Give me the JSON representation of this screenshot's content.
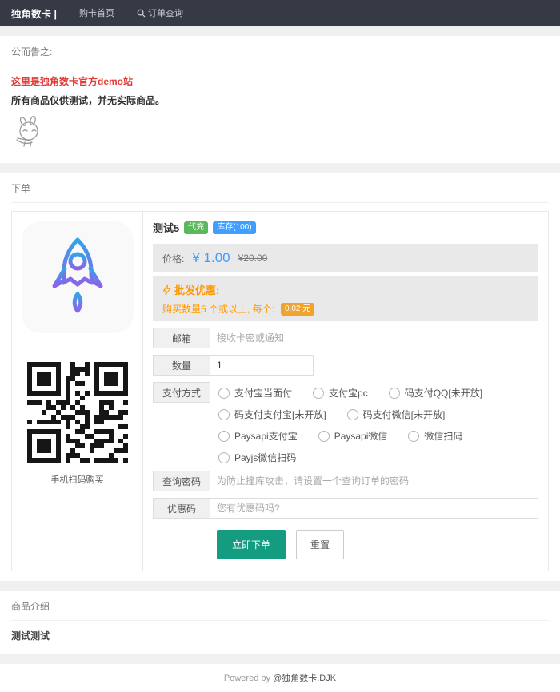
{
  "navbar": {
    "brand": "独角数卡 |",
    "home_label": "购卡首页",
    "order_query_label": "订单查询"
  },
  "announcement": {
    "title": "公而告之:",
    "line1": "这里是独角数卡官方demo站",
    "line2": "所有商品仅供测试，并无实际商品。"
  },
  "order": {
    "title": "下单",
    "product": {
      "name": "测试5",
      "type_badge": "代充",
      "stock_badge": "库存(100)",
      "price_label": "价格:",
      "price": "¥ 1.00",
      "original_price": "¥20.00",
      "wholesale_title": "批发优惠:",
      "wholesale_desc": "购买数量5 个或以上, 每个:",
      "wholesale_badge": "0.02 元",
      "qr_caption": "手机扫码购买"
    },
    "form": {
      "email_label": "邮箱",
      "email_placeholder": "接收卡密或通知",
      "quantity_label": "数量",
      "quantity_value": "1",
      "payment_label": "支付方式",
      "payments": [
        "支付宝当面付",
        "支付宝pc",
        "码支付QQ[未开放]",
        "码支付支付宝[未开放]",
        "码支付微信[未开放]",
        "Paysapi支付宝",
        "Paysapi微信",
        "微信扫码",
        "Payjs微信扫码"
      ],
      "search_pwd_label": "查询密码",
      "search_pwd_placeholder": "为防止撞库攻击，请设置一个查询订单的密码",
      "coupon_label": "优惠码",
      "coupon_placeholder": "您有优惠码吗?",
      "submit_label": "立即下单",
      "reset_label": "重置"
    }
  },
  "detail": {
    "title": "商品介绍",
    "content": "测试测试"
  },
  "footer": {
    "powered": "Powered by ",
    "brand": "@独角数卡.DJK"
  },
  "icons": {
    "nav_query": "search-icon",
    "wholesale": "lightning-icon",
    "product_image": "rocket-icon",
    "qr": "qr-code",
    "announcement_image": "kaomoji-emoticon"
  },
  "colors": {
    "navbar_bg": "#353a45",
    "red": "#e53935",
    "price_blue": "#409eff",
    "orange": "#ff9800",
    "badge_green": "#5cb85c",
    "badge_blue": "#409eff",
    "badge_orange": "#f0a32e",
    "button_green": "#139c7f"
  }
}
